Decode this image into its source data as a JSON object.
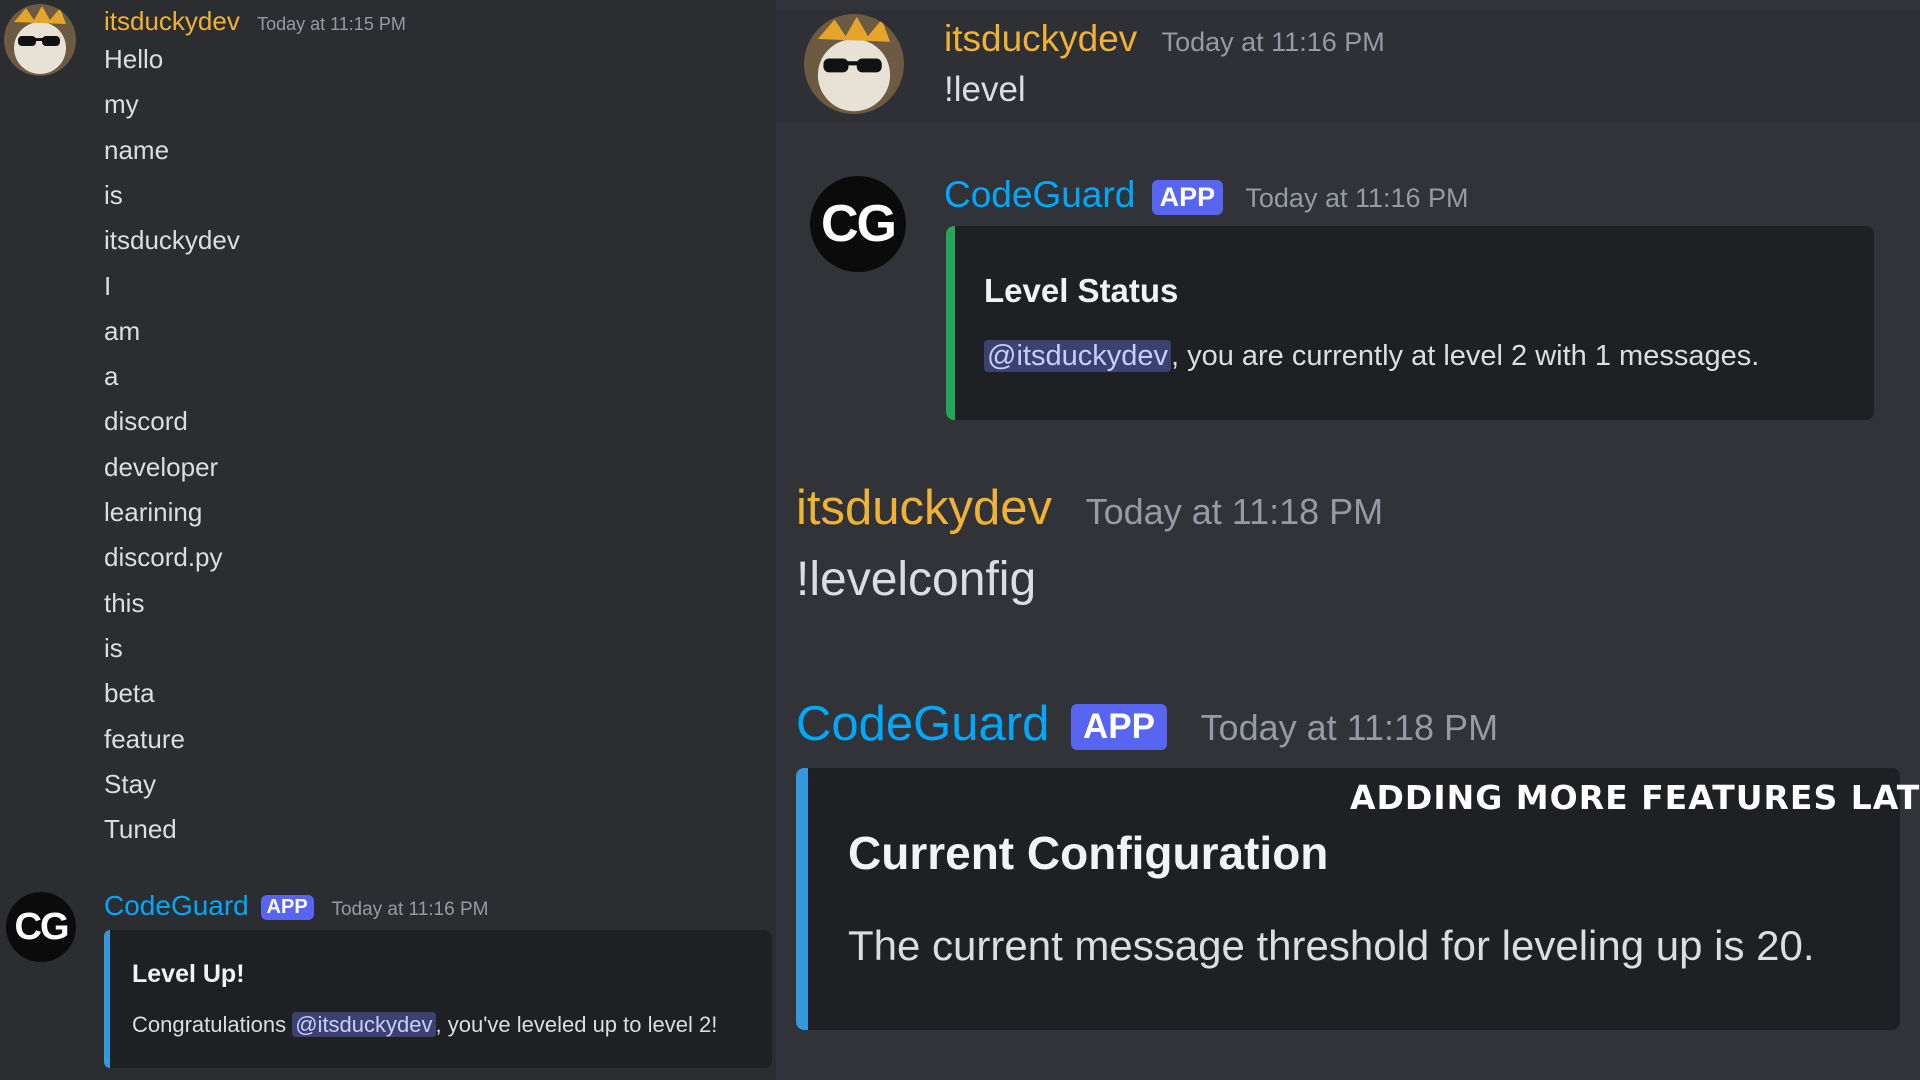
{
  "left": {
    "message1": {
      "username": "itsduckydev",
      "timestamp": "Today at 11:15 PM",
      "lines": [
        "Hello",
        "my",
        "name",
        "is",
        "itsduckydev",
        "I",
        "am",
        "a",
        "discord",
        "developer",
        "learining",
        "discord.py",
        "this",
        "is",
        "beta",
        "feature",
        "Stay",
        "Tuned"
      ]
    },
    "message2": {
      "username": "CodeGuard",
      "badge": "APP",
      "timestamp": "Today at 11:16 PM",
      "avatar_text": "CG",
      "embed": {
        "title": "Level Up!",
        "text_before": "Congratulations ",
        "mention": "@itsduckydev",
        "text_after": ", you've leveled up to level 2!"
      }
    }
  },
  "right": {
    "message1": {
      "username": "itsduckydev",
      "timestamp": "Today at 11:16 PM",
      "content": "!level"
    },
    "message2": {
      "username": "CodeGuard",
      "badge": "APP",
      "timestamp": "Today at 11:16 PM",
      "avatar_text": "CG",
      "embed": {
        "title": "Level Status",
        "mention": "@itsduckydev",
        "text_after": ", you are currently at level 2 with 1 messages."
      }
    },
    "message3": {
      "username": "itsduckydev",
      "timestamp": "Today at 11:18 PM",
      "content": "!levelconfig"
    },
    "message4": {
      "username": "CodeGuard",
      "badge": "APP",
      "timestamp": "Today at 11:18 PM",
      "embed": {
        "title": "Current Configuration",
        "text": "The current message threshold for leveling up is 20."
      }
    },
    "overlay_caption": "ADDING MORE FEATURES LATER"
  },
  "colors": {
    "background": "#2b2d31",
    "username_user": "#f0b232",
    "username_bot": "#00a8fc",
    "badge": "#5865f2",
    "embed_bar_green": "#23a55a",
    "embed_bar_blue": "#3498db"
  }
}
